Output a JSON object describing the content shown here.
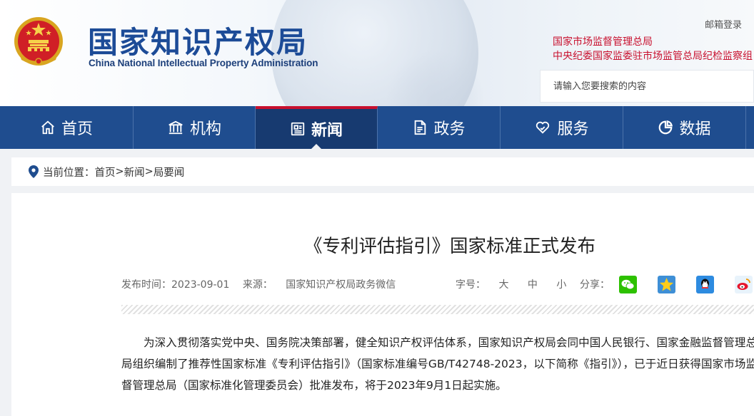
{
  "header": {
    "logo_cn": "国家知识产权局",
    "logo_en": "China National Intellectual Property Administration",
    "mail_login": "邮箱登录",
    "links": [
      "国家市场监督管理总局",
      "中央纪委国家监委驻市场监管总局纪检监察组"
    ],
    "search_placeholder": "请输入您要搜索的内容"
  },
  "nav": {
    "items": [
      {
        "label": "首页",
        "icon": "home-icon"
      },
      {
        "label": "机构",
        "icon": "institution-icon"
      },
      {
        "label": "新闻",
        "icon": "newspaper-icon",
        "active": true
      },
      {
        "label": "政务",
        "icon": "document-icon"
      },
      {
        "label": "服务",
        "icon": "heart-hand-icon"
      },
      {
        "label": "数据",
        "icon": "pie-chart-icon"
      }
    ]
  },
  "breadcrumb": {
    "prefix": "当前位置：",
    "items": [
      "首页",
      "新闻",
      "局要闻"
    ],
    "separator": ">"
  },
  "article": {
    "title": "《专利评估指引》国家标准正式发布",
    "publish_label": "发布时间：",
    "publish_date": "2023-09-01",
    "source_label": "来源：",
    "source": "国家知识产权局政务微信",
    "font_label": "字号：",
    "font_sizes": [
      "大",
      "中",
      "小"
    ],
    "share_label": "分享：",
    "share_icons": [
      "wechat-icon",
      "qzone-icon",
      "qq-icon",
      "weibo-icon"
    ],
    "paragraphs": [
      "为深入贯彻落实党中央、国务院决策部署，健全知识产权评估体系，国家知识产权局会同中国人民银行、国家金融监督管理总局组织编制了推荐性国家标准《专利评估指引》（国家标准编号GB/T42748-2023，以下简称《指引》），已于近日获得国家市场监督管理总局（国家标准化管理委员会）批准发布，将于2023年9月1日起实施。"
    ]
  },
  "colors": {
    "brand_blue": "#1f4d8f",
    "nav_active": "#173a70",
    "accent_red": "#c8102e"
  }
}
